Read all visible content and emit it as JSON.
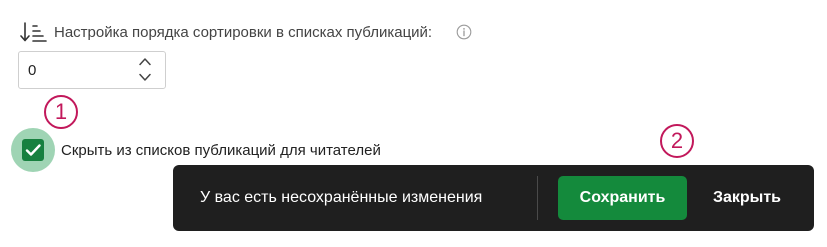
{
  "sort_setting": {
    "label": "Настройка порядка сортировки в списках публикаций:",
    "icon": "sort-order-icon",
    "info_icon": "info-icon",
    "value": "0"
  },
  "hide_setting": {
    "checked": true,
    "label": "Скрыть из списков публикаций для читателей"
  },
  "callouts": {
    "first": "1",
    "second": "2"
  },
  "save_bar": {
    "message": "У вас есть несохранённые изменения",
    "save_label": "Сохранить",
    "close_label": "Закрыть"
  },
  "colors": {
    "accent_green": "#148a3c",
    "callout_magenta": "#c2185b",
    "bar_background": "#1f1f1f"
  }
}
